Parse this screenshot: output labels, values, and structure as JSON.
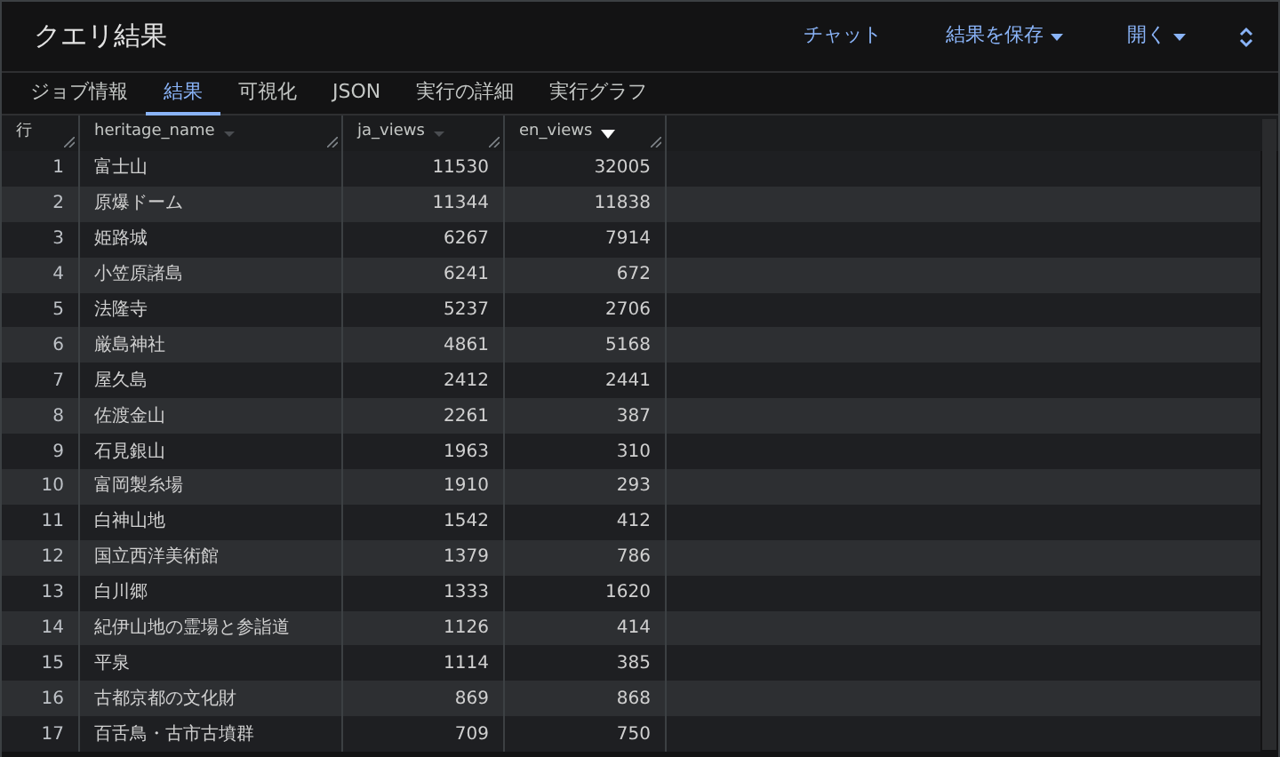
{
  "panel": {
    "title": "クエリ結果"
  },
  "actions": [
    {
      "label": "チャット",
      "dropdown": false
    },
    {
      "label": "結果を保存",
      "dropdown": true
    },
    {
      "label": "開く",
      "dropdown": true
    }
  ],
  "tabs": [
    {
      "label": "ジョブ情報",
      "selected": false
    },
    {
      "label": "結果",
      "selected": true
    },
    {
      "label": "可視化",
      "selected": false
    },
    {
      "label": "JSON",
      "selected": false
    },
    {
      "label": "実行の詳細",
      "selected": false
    },
    {
      "label": "実行グラフ",
      "selected": false
    }
  ],
  "table": {
    "columns": [
      {
        "label": "行"
      },
      {
        "label": "heritage_name",
        "sorted": false
      },
      {
        "label": "ja_views",
        "sorted": false
      },
      {
        "label": "en_views",
        "sorted": true
      }
    ],
    "rows": [
      [
        "1",
        "富士山",
        "11530",
        "32005"
      ],
      [
        "2",
        "原爆ドーム",
        "11344",
        "11838"
      ],
      [
        "3",
        "姫路城",
        "6267",
        "7914"
      ],
      [
        "4",
        "小笠原諸島",
        "6241",
        "672"
      ],
      [
        "5",
        "法隆寺",
        "5237",
        "2706"
      ],
      [
        "6",
        "厳島神社",
        "4861",
        "5168"
      ],
      [
        "7",
        "屋久島",
        "2412",
        "2441"
      ],
      [
        "8",
        "佐渡金山",
        "2261",
        "387"
      ],
      [
        "9",
        "石見銀山",
        "1963",
        "310"
      ],
      [
        "10",
        "富岡製糸場",
        "1910",
        "293"
      ],
      [
        "11",
        "白神山地",
        "1542",
        "412"
      ],
      [
        "12",
        "国立西洋美術館",
        "1379",
        "786"
      ],
      [
        "13",
        "白川郷",
        "1333",
        "1620"
      ],
      [
        "14",
        "紀伊山地の霊場と参詣道",
        "1126",
        "414"
      ],
      [
        "15",
        "平泉",
        "1114",
        "385"
      ],
      [
        "16",
        "古都京都の文化財",
        "869",
        "868"
      ],
      [
        "17",
        "百舌鳥・古市古墳群",
        "709",
        "750"
      ]
    ]
  }
}
